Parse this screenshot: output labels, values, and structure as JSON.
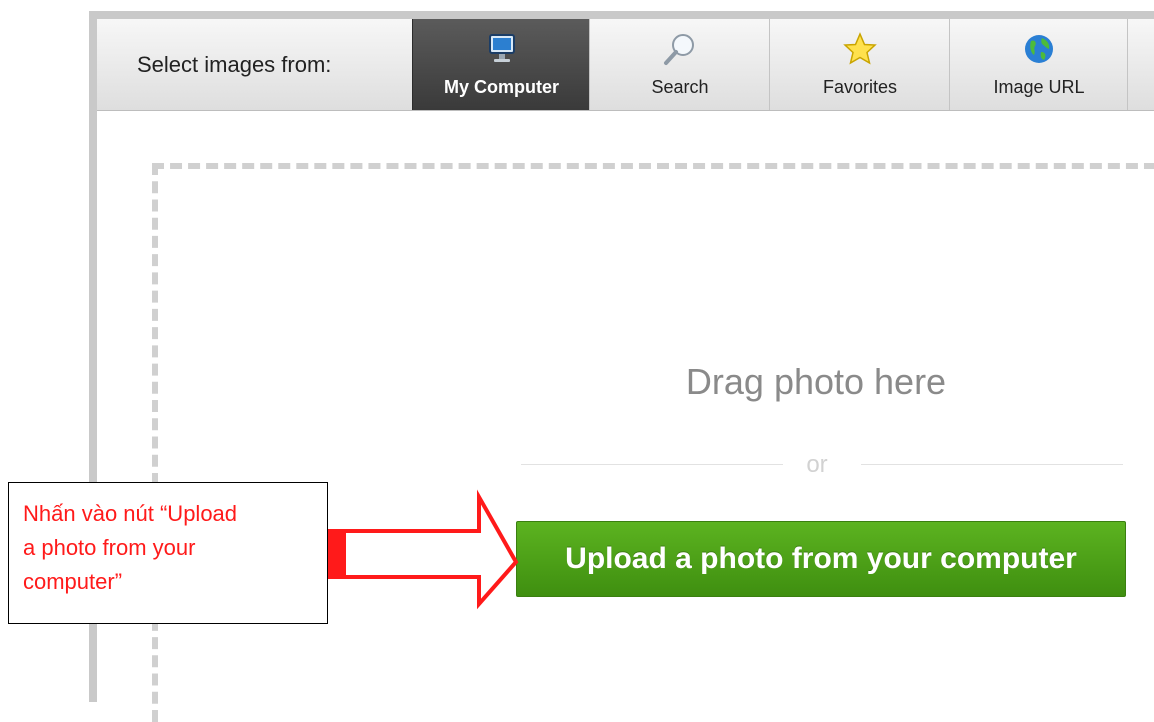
{
  "toolbar": {
    "label": "Select images from:",
    "tabs": [
      {
        "label": "My Computer",
        "icon": "monitor-icon",
        "active": true
      },
      {
        "label": "Search",
        "icon": "magnifier-icon",
        "active": false
      },
      {
        "label": "Favorites",
        "icon": "star-icon",
        "active": false
      },
      {
        "label": "Image URL",
        "icon": "globe-icon",
        "active": false
      }
    ]
  },
  "drop_zone": {
    "drag_text": "Drag photo here",
    "or_text": "or",
    "upload_button_label": "Upload a photo from your computer"
  },
  "annotation": {
    "text": "Nhấn vào nút “Upload\na photo from your\ncomputer”",
    "color": "#ff1a1a"
  },
  "colors": {
    "upload_button": "#4ea01a",
    "active_tab": "#444444"
  }
}
